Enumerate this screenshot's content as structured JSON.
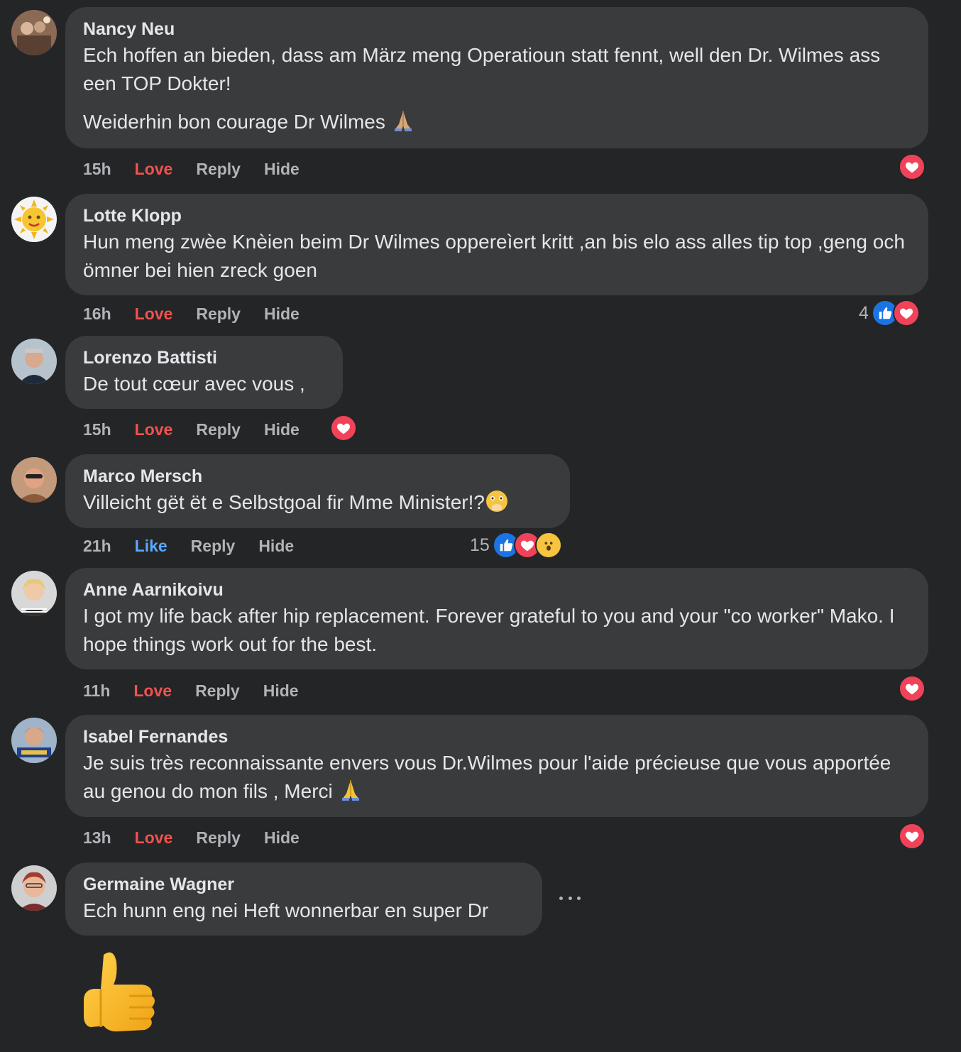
{
  "comments": [
    {
      "author": "Nancy Neu",
      "paragraphs": [
        "Ech hoffen an bieden, dass am März meng Operatioun statt fennt, well den Dr. Wilmes ass een TOP Dokter!",
        "Weiderhin bon courage Dr Wilmes"
      ],
      "time": "15h",
      "react_label": "Love",
      "reply": "Reply",
      "hide": "Hide",
      "reaction_count": "",
      "reactions": [
        "heart"
      ],
      "emoji": "folded-hands"
    },
    {
      "author": "Lotte Klopp",
      "paragraphs": [
        "Hun meng zwèe Knèien beim Dr Wilmes opperеìert kritt ,an bis elo ass alles tip top ,geng och ömner bei hien zreck goen"
      ],
      "time": "16h",
      "react_label": "Love",
      "reply": "Reply",
      "hide": "Hide",
      "reaction_count": "4",
      "reactions": [
        "like",
        "heart"
      ]
    },
    {
      "author": "Lorenzo Battisti",
      "paragraphs": [
        "De tout cœur avec vous ,"
      ],
      "time": "15h",
      "react_label": "Love",
      "reply": "Reply",
      "hide": "Hide",
      "reaction_count": "",
      "reactions": [
        "heart"
      ]
    },
    {
      "author": "Marco Mersch",
      "paragraphs": [
        "Villeicht gët ët e Selbstgoal fir Mme Minister!?"
      ],
      "time": "21h",
      "react_label": "Like",
      "reply": "Reply",
      "hide": "Hide",
      "reaction_count": "15",
      "reactions": [
        "like",
        "heart",
        "wow"
      ],
      "emoji": "face-hand-over-mouth"
    },
    {
      "author": "Anne Aarnikoivu",
      "paragraphs": [
        "I got my life back after hip replacement. Forever grateful to you and your \"co worker\" Mako. I hope things work out for the best."
      ],
      "time": "11h",
      "react_label": "Love",
      "reply": "Reply",
      "hide": "Hide",
      "reaction_count": "",
      "reactions": [
        "heart"
      ]
    },
    {
      "author": "Isabel Fernandes",
      "paragraphs": [
        "Je suis très reconnaissante envers vous Dr.Wilmes pour l'aide précieuse que vous apportée au genou do mon fils , Merci"
      ],
      "time": "13h",
      "react_label": "Love",
      "reply": "Reply",
      "hide": "Hide",
      "reaction_count": "",
      "reactions": [
        "heart"
      ],
      "emoji": "folded-hands"
    },
    {
      "author": "Germaine Wagner",
      "paragraphs": [
        "Ech hunn eng nei Heft wonnerbar en super Dr"
      ],
      "sticker": "thumbs-up"
    }
  ],
  "colors": {
    "background": "#242526",
    "bubble": "#3a3b3c",
    "love": "#f0524f",
    "like": "#5aa7ff",
    "heart_icon": "#f0435a",
    "like_icon": "#1b74e4"
  }
}
